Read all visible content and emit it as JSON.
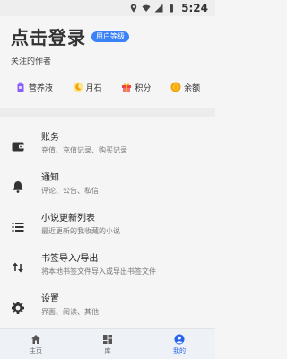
{
  "status_bar": {
    "time": "5:24",
    "icons": [
      "location-icon",
      "wifi-icon",
      "cellular-icon",
      "battery-icon"
    ]
  },
  "header": {
    "title": "点击登录",
    "badge": "用户等级",
    "subtitle": "关注的作者"
  },
  "assets": [
    {
      "label": "营养液",
      "icon": "nutrition-bottle-icon",
      "color": "#8b5cf6"
    },
    {
      "label": "月石",
      "icon": "moonstone-icon",
      "color": "#f59e0b"
    },
    {
      "label": "积分",
      "icon": "gift-icon",
      "color": "#ef4444"
    },
    {
      "label": "余额",
      "icon": "coin-icon",
      "color": "#f59e0b"
    }
  ],
  "menu": [
    {
      "title": "账务",
      "subtitle": "充值、充值记录、购买记录",
      "icon": "wallet-icon"
    },
    {
      "title": "通知",
      "subtitle": "评论、公告、私信",
      "icon": "bell-icon"
    },
    {
      "title": "小说更新列表",
      "subtitle": "最近更新的我收藏的小说",
      "icon": "list-icon"
    },
    {
      "title": "书签导入/导出",
      "subtitle": "将本地书签文件导入或导出书签文件",
      "icon": "import-export-icon"
    },
    {
      "title": "设置",
      "subtitle": "界面、阅读、其他",
      "icon": "gear-icon"
    }
  ],
  "bottom_nav": [
    {
      "label": "主页",
      "icon": "home-icon",
      "active": false
    },
    {
      "label": "库",
      "icon": "library-icon",
      "active": false
    },
    {
      "label": "我的",
      "icon": "account-icon",
      "active": true
    }
  ],
  "colors": {
    "accent": "#2563eb",
    "badge": "#3b82f6",
    "background": "#f5f5f5"
  }
}
